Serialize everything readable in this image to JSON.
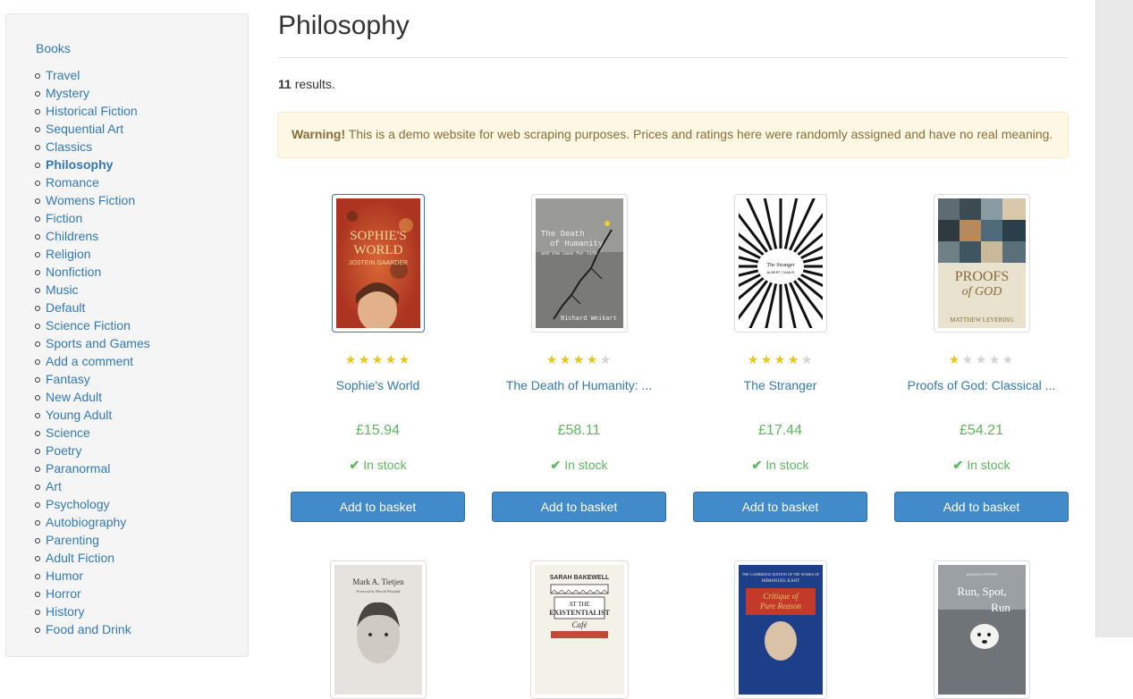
{
  "sidebar": {
    "top_link": "Books",
    "categories": [
      "Travel",
      "Mystery",
      "Historical Fiction",
      "Sequential Art",
      "Classics",
      "Philosophy",
      "Romance",
      "Womens Fiction",
      "Fiction",
      "Childrens",
      "Religion",
      "Nonfiction",
      "Music",
      "Default",
      "Science Fiction",
      "Sports and Games",
      "Add a comment",
      "Fantasy",
      "New Adult",
      "Young Adult",
      "Science",
      "Poetry",
      "Paranormal",
      "Art",
      "Psychology",
      "Autobiography",
      "Parenting",
      "Adult Fiction",
      "Humor",
      "Horror",
      "History",
      "Food and Drink"
    ],
    "active_category": "Philosophy"
  },
  "page": {
    "title": "Philosophy",
    "results_count": "11",
    "results_suffix": " results.",
    "warning_strong": "Warning!",
    "warning_text": " This is a demo website for web scraping purposes. Prices and ratings here were randomly assigned and have no real meaning."
  },
  "products": [
    {
      "title": "Sophie's World",
      "price": "£15.94",
      "rating": 5,
      "stock": "In stock",
      "button": "Add to basket",
      "cover": {
        "bg": "#c8412a",
        "line1": "SOPHIE'S",
        "line2": "WORLD",
        "line3": "JOSTEIN GAARDER",
        "text_color": "#f3d59a"
      }
    },
    {
      "title": "The Death of Humanity: ...",
      "price": "£58.11",
      "rating": 4,
      "stock": "In stock",
      "button": "Add to basket",
      "cover": {
        "bg": "#7a7a78",
        "line1": "The Death",
        "line2": "of Humanity",
        "line3": "Richard Weikart",
        "text_color": "#f0f0f0"
      }
    },
    {
      "title": "The Stranger",
      "price": "£17.44",
      "rating": 4,
      "stock": "In stock",
      "button": "Add to basket",
      "cover": {
        "bg": "#ffffff",
        "line1": "The Stranger",
        "line2": "ALBERT CAMUS",
        "line3": "",
        "text_color": "#222222"
      }
    },
    {
      "title": "Proofs of God: Classical ...",
      "price": "£54.21",
      "rating": 1,
      "stock": "In stock",
      "button": "Add to basket",
      "cover": {
        "bg": "#e8e2cf",
        "line1": "PROOFS",
        "line2": "of GOD",
        "line3": "MATTHEW LEVERING",
        "text_color": "#8b6b3a"
      }
    }
  ],
  "second_row": [
    {
      "cover": {
        "bg": "#e6e3de",
        "line1": "Mark A. Tietjen",
        "text_color": "#333333"
      }
    },
    {
      "cover": {
        "bg": "#f4f1e8",
        "line1": "SARAH BAKEWELL",
        "text_color": "#333333"
      }
    },
    {
      "cover": {
        "bg": "#1d3f8a",
        "line1": "Critique of",
        "text_color": "#e8c36a"
      }
    },
    {
      "cover": {
        "bg": "#6f7478",
        "line1": "Run, Spot, Run",
        "text_color": "#ffffff"
      }
    }
  ],
  "colors": {
    "link": "#337ab7",
    "price": "#5cb85c",
    "star_on": "#e6c81c",
    "star_off": "#d5d5d5",
    "button": "#428bca",
    "warning_bg": "#fcf8e3",
    "warning_text": "#8a6d3b"
  }
}
